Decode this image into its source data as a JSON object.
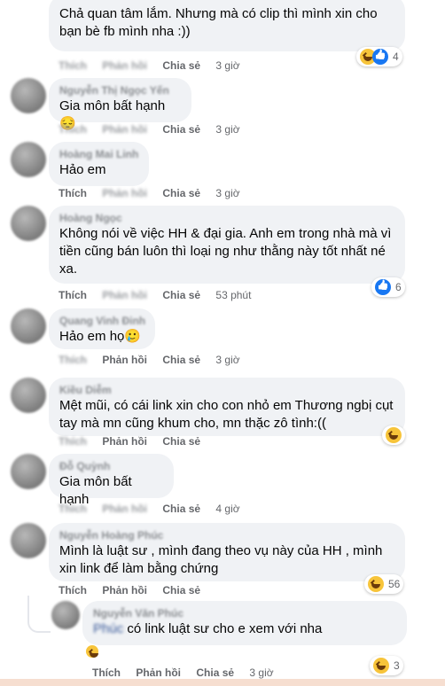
{
  "actions": {
    "like": "Thích",
    "reply": "Phản hồi",
    "share": "Chia sẻ"
  },
  "comments": [
    {
      "text": "Chả quan tâm lắm. Nhưng mà có clip thì mình xin cho bạn bè fb mình nha :))",
      "time": "3 giờ",
      "reactions": "4",
      "reaction_icons": [
        "haha-icon",
        "like-icon"
      ]
    },
    {
      "author": "Nguyễn Thị Ngọc Yến",
      "text": "Gia môn bất hạnh 😔",
      "time": "3 giờ"
    },
    {
      "author": "Hoàng Mai Linh",
      "text": "Hảo em",
      "time": "3 giờ"
    },
    {
      "author": "Hoàng Ngọc",
      "text": "Không nói về việc HH & đại gia. Anh em trong nhà mà vì tiền cũng bán luôn thì loại ng như thằng này tốt nhất né xa.",
      "time": "53 phút",
      "reactions": "6",
      "reaction_icons": [
        "like-icon"
      ]
    },
    {
      "author": "Quang Vinh Đinh",
      "text": "Hảo em họ🥲",
      "time": "3 giờ"
    },
    {
      "author": "Kiều Diễm",
      "text": "Mệt mũi, có cái link xin cho con nhỏ em Thương ngbị cụt tay mà mn cũng khum cho, mn thặc zô tình:((",
      "time": "",
      "reaction_icons": [
        "haha-icon"
      ]
    },
    {
      "author": "Đỗ Quỳnh",
      "text": "Gia môn bất hạnh",
      "time": "4 giờ"
    },
    {
      "author": "Nguyễn Hoàng Phúc",
      "text": "Mình là luật sư , mình đang theo vụ này của HH , mình xin link để làm bằng chứng",
      "time": "",
      "reactions": "56",
      "reaction_icons": [
        "haha-icon"
      ]
    },
    {
      "author": "Nguyễn Văn Phúc",
      "text": "có link luật sư cho e xem với nha",
      "text_prefix": "Phúc",
      "time": "3 giờ",
      "reactions": "3",
      "reaction_icons": [
        "haha-icon"
      ]
    }
  ]
}
